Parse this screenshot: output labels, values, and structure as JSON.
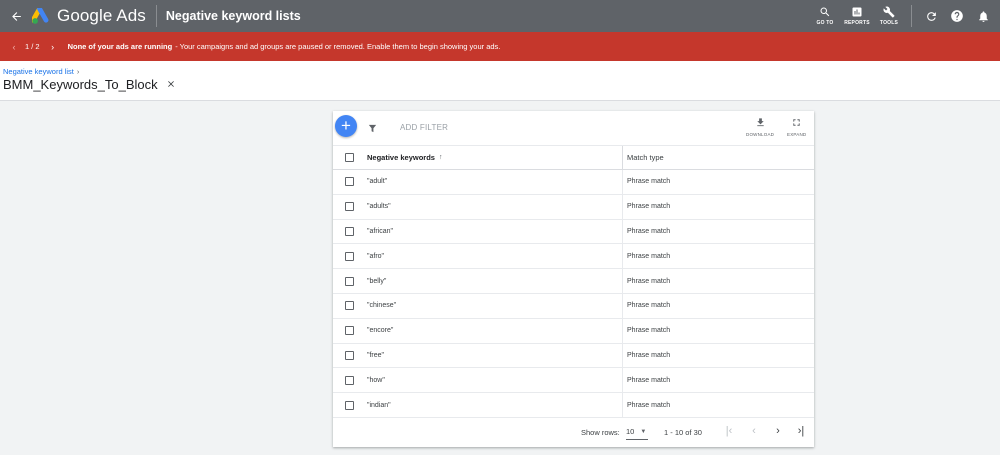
{
  "topbar": {
    "back_icon": "arrow-back-icon",
    "app_name": "Google Ads",
    "page_title": "Negative keyword lists",
    "tools": [
      {
        "icon": "search-icon",
        "label": "GO TO"
      },
      {
        "icon": "reports-icon",
        "label": "REPORTS"
      },
      {
        "icon": "wrench-icon",
        "label": "TOOLS"
      }
    ]
  },
  "alert": {
    "counter": "1 / 2",
    "strong": "None of your ads are running",
    "message": "- Your campaigns and ad groups are paused or removed. Enable them to begin showing your ads.",
    "bg_color": "#c5372c"
  },
  "header": {
    "breadcrumb": "Negative keyword list",
    "breadcrumb_sep": "›",
    "list_name": "BMM_Keywords_To_Block"
  },
  "table": {
    "add_filter": "ADD FILTER",
    "download_label": "DOWNLOAD",
    "expand_label": "EXPAND",
    "columns": [
      "Negative keywords",
      "Match type"
    ],
    "rows": [
      {
        "keyword": "\"adult\"",
        "match": "Phrase match"
      },
      {
        "keyword": "\"adults\"",
        "match": "Phrase match"
      },
      {
        "keyword": "\"african\"",
        "match": "Phrase match"
      },
      {
        "keyword": "\"afro\"",
        "match": "Phrase match"
      },
      {
        "keyword": "\"belly\"",
        "match": "Phrase match"
      },
      {
        "keyword": "\"chinese\"",
        "match": "Phrase match"
      },
      {
        "keyword": "\"encore\"",
        "match": "Phrase match"
      },
      {
        "keyword": "\"free\"",
        "match": "Phrase match"
      },
      {
        "keyword": "\"how\"",
        "match": "Phrase match"
      },
      {
        "keyword": "\"indian\"",
        "match": "Phrase match"
      }
    ],
    "footer": {
      "show_rows_label": "Show rows:",
      "rows_per_page": "10",
      "range": "1 - 10 of 30"
    }
  },
  "colors": {
    "topbar": "#5f6368",
    "accent": "#4285f4",
    "link": "#1a73e8"
  }
}
